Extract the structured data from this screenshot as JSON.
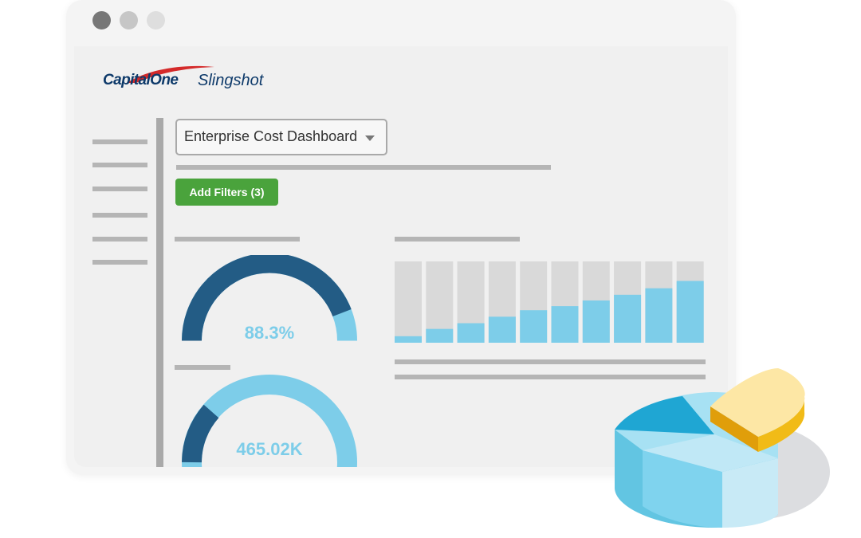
{
  "window": {
    "controls": [
      {
        "name": "close",
        "color": "#777777"
      },
      {
        "name": "minimize",
        "color": "#c6c6c6"
      },
      {
        "name": "maximize",
        "color": "#dedede"
      }
    ]
  },
  "brand": {
    "company": "CapitalOne",
    "product": "Slingshot"
  },
  "header": {
    "dashboard_select": "Enterprise Cost Dashboard",
    "add_filters_label": "Add Filters (3)"
  },
  "gauges": [
    {
      "value_label": "88.3%",
      "fraction": 0.883
    },
    {
      "value_label": "465.02K"
    }
  ],
  "chart_data": {
    "type": "bar",
    "stacked": true,
    "series": [
      {
        "values": [
          0.08,
          0.17,
          0.24,
          0.32,
          0.4,
          0.45,
          0.52,
          0.59,
          0.67,
          0.76
        ]
      }
    ],
    "ylim": [
      0,
      1
    ]
  },
  "colors": {
    "navy": "#235c85",
    "light_blue": "#7dcde9",
    "bar_fill": "#7dcde9",
    "bar_track": "#d9d9d9",
    "green": "#4aa33c",
    "gold": "#f1bb17",
    "gold_light": "#fde7a5"
  }
}
